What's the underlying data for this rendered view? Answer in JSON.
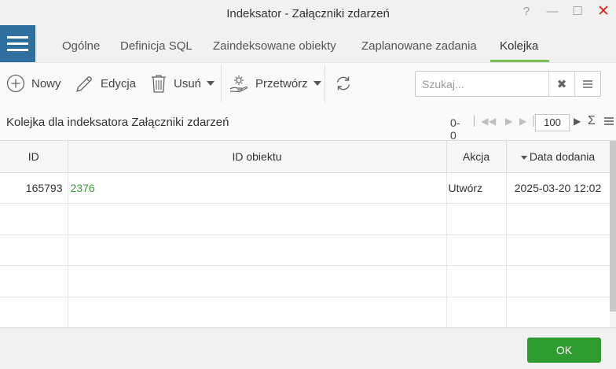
{
  "window": {
    "title": "Indeksator - Załączniki zdarzeń",
    "help": "?",
    "minimize": "—",
    "maximize": "☐",
    "close": "✕"
  },
  "tabs": [
    {
      "label": "Ogólne"
    },
    {
      "label": "Definicja SQL"
    },
    {
      "label": "Zaindeksowane obiekty"
    },
    {
      "label": "Zaplanowane zadania"
    },
    {
      "label": "Kolejka",
      "active": true
    }
  ],
  "toolbar": {
    "new_label": "Nowy",
    "edit_label": "Edycja",
    "delete_label": "Usuń",
    "process_label": "Przetwórz"
  },
  "search": {
    "placeholder": "Szukaj...",
    "value": ""
  },
  "subheader": {
    "caption": "Kolejka dla indeksatora Załączniki zdarzeń",
    "count": "0-0",
    "page_size": "100"
  },
  "grid": {
    "columns": [
      {
        "label": "ID"
      },
      {
        "label": "ID obiektu"
      },
      {
        "label": "Akcja"
      },
      {
        "label": "Data dodania",
        "sorted": "desc"
      }
    ],
    "rows": [
      {
        "id": "165793",
        "object_id": "2376",
        "action": "Utwórz",
        "date_added": "2025-03-20 12:02"
      }
    ]
  },
  "footer": {
    "ok_label": "OK"
  },
  "colors": {
    "accent": "#2f6f9e",
    "tab_active": "#7cbf54",
    "link": "#3a9a3a",
    "ok_button": "#2e9c2e",
    "close": "#e0241c"
  }
}
